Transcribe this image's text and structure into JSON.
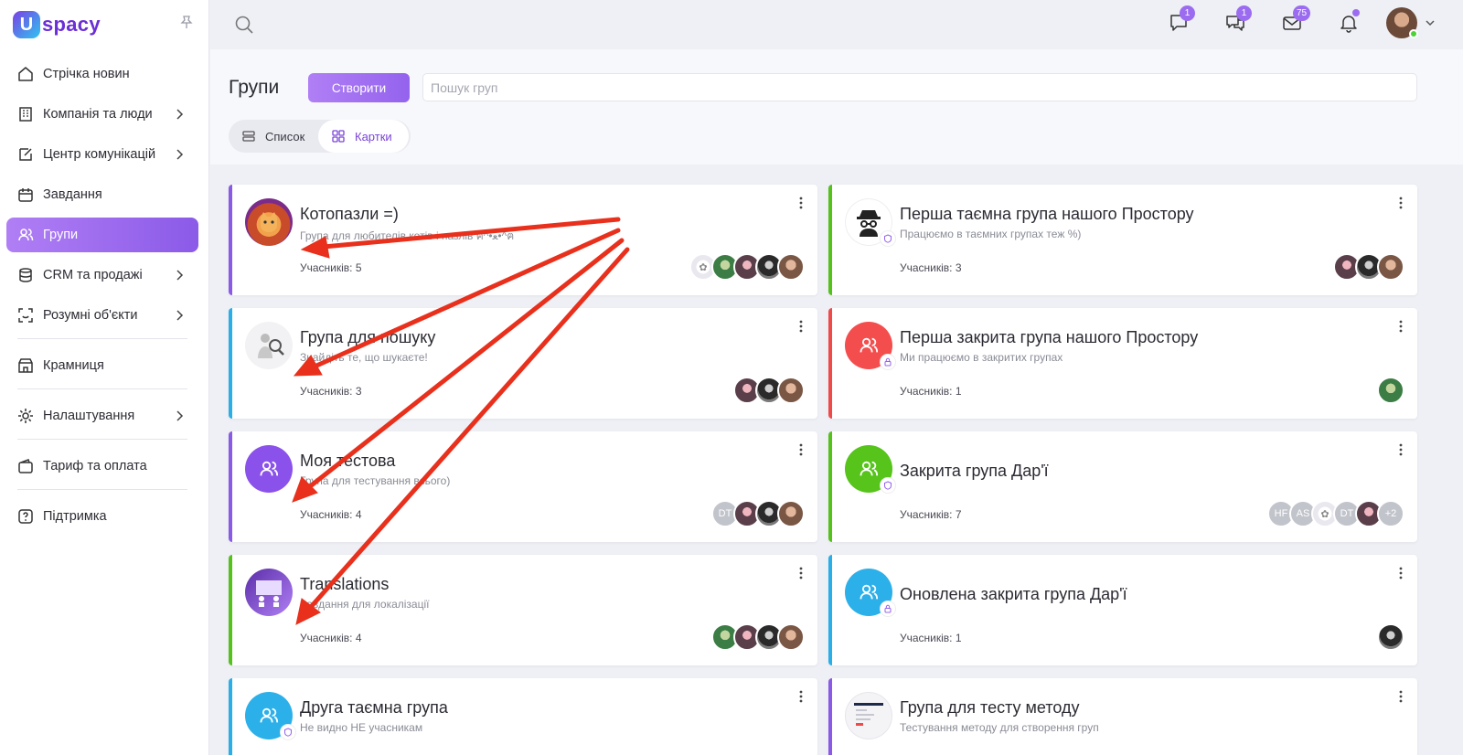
{
  "brand": {
    "name": "spacy",
    "mark": "U"
  },
  "sidebar": {
    "items": [
      {
        "label": "Стрічка новин",
        "icon": "home-icon",
        "chevron": false,
        "active": false
      },
      {
        "label": "Компанія та люди",
        "icon": "building-icon",
        "chevron": true,
        "active": false
      },
      {
        "label": "Центр комунікацій",
        "icon": "edit-icon",
        "chevron": true,
        "active": false
      },
      {
        "label": "Завдання",
        "icon": "calendar-icon",
        "chevron": false,
        "active": false
      },
      {
        "label": "Групи",
        "icon": "users-icon",
        "chevron": false,
        "active": true
      },
      {
        "label": "CRM та продажі",
        "icon": "database-icon",
        "chevron": true,
        "active": false
      },
      {
        "label": "Розумні об'єкти",
        "icon": "scan-icon",
        "chevron": true,
        "active": false
      },
      {
        "label": "Крамниця",
        "icon": "store-icon",
        "chevron": false,
        "active": false
      },
      {
        "label": "Налаштування",
        "icon": "gear-icon",
        "chevron": true,
        "active": false
      },
      {
        "label": "Тариф та оплата",
        "icon": "wallet-icon",
        "chevron": false,
        "active": false
      },
      {
        "label": "Підтримка",
        "icon": "help-icon",
        "chevron": false,
        "active": false
      }
    ]
  },
  "topbar": {
    "chat_badge": "1",
    "messages_badge": "1",
    "mail_badge": "75"
  },
  "page": {
    "title": "Групи",
    "create_label": "Створити",
    "search_placeholder": "Пошук груп",
    "view_list": "Список",
    "view_cards": "Картки"
  },
  "colors": {
    "accent": "#9463ee",
    "purple": "#8a5ae6",
    "blue": "#29aee8",
    "green": "#55c11b",
    "red": "#ef4a4a",
    "arrow": "#e8301c"
  },
  "cards": [
    {
      "title": "Котопазли =)",
      "desc": "Група для любителів котів і пазлів ฅ^•ﻌ•^ฅ",
      "members": "Учасників: 5"
    },
    {
      "title": "Перша таємна група нашого Простору",
      "desc": "Працюємо в таємних групах теж %)",
      "members": "Учасників: 3"
    },
    {
      "title": "Група для пошуку",
      "desc": "Знайдіть те, що шукаєте!",
      "members": "Учасників: 3"
    },
    {
      "title": "Перша закрита група нашого Простору",
      "desc": "Ми працюємо в закритих групах",
      "members": "Учасників: 1"
    },
    {
      "title": "Моя тестова",
      "desc": "Група для тестування всього)",
      "members": "Учасників: 4",
      "face_initials": "DT"
    },
    {
      "title": "Закрита група Дар'ї",
      "desc": "",
      "members": "Учасників: 7",
      "face_initials": [
        "HF",
        "AS",
        "DT",
        "+2"
      ]
    },
    {
      "title": "Translations",
      "desc": "Завдання для локалізації",
      "members": "Учасників: 4"
    },
    {
      "title": "Оновлена закрита група Дар'ї",
      "desc": "",
      "members": "Учасників: 1"
    },
    {
      "title": "Друга таємна група",
      "desc": "Не видно НЕ учасникам",
      "members": ""
    },
    {
      "title": "Група для тесту методу",
      "desc": "Тестування методу для створення груп",
      "members": ""
    }
  ]
}
